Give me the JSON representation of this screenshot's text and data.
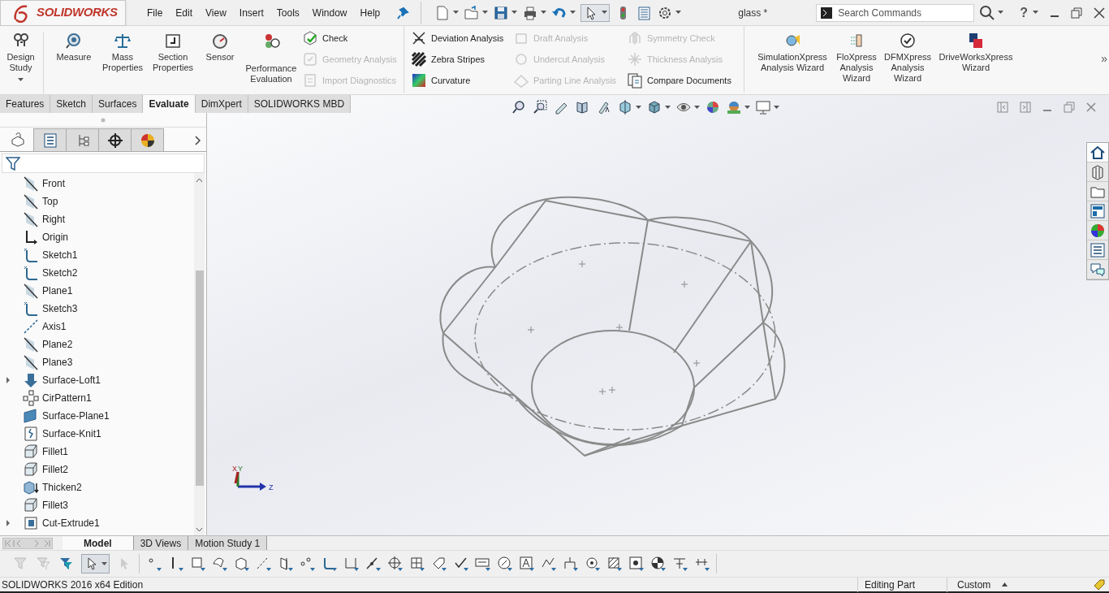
{
  "logo": "SOLIDWORKS",
  "menu": [
    "File",
    "Edit",
    "View",
    "Insert",
    "Tools",
    "Window",
    "Help"
  ],
  "document_title": "glass *",
  "search": {
    "placeholder": "Search Commands"
  },
  "help": "?",
  "ribbon": {
    "large_buttons": [
      {
        "label": "Design\nStudy",
        "dropdown": true
      },
      {
        "label": "Measure",
        "dropdown": false
      },
      {
        "label": "Mass\nProperties",
        "dropdown": false
      },
      {
        "label": "Section\nProperties",
        "dropdown": false
      },
      {
        "label": "Sensor",
        "dropdown": false
      },
      {
        "label": "Performance\nEvaluation",
        "dropdown": false
      }
    ],
    "small_groups": [
      [
        {
          "label": "Check",
          "disabled": false
        },
        {
          "label": "Geometry Analysis",
          "disabled": true
        },
        {
          "label": "Import Diagnostics",
          "disabled": true
        }
      ],
      [
        {
          "label": "Deviation Analysis",
          "disabled": false
        },
        {
          "label": "Zebra Stripes",
          "disabled": false
        },
        {
          "label": "Curvature",
          "disabled": false
        }
      ],
      [
        {
          "label": "Draft Analysis",
          "disabled": true
        },
        {
          "label": "Undercut Analysis",
          "disabled": true
        },
        {
          "label": "Parting Line Analysis",
          "disabled": true
        }
      ],
      [
        {
          "label": "Symmetry Check",
          "disabled": true
        },
        {
          "label": "Thickness Analysis",
          "disabled": true
        },
        {
          "label": "Compare Documents",
          "disabled": false
        }
      ]
    ],
    "wizards": [
      {
        "label": "SimulationXpress\nAnalysis Wizard"
      },
      {
        "label": "FloXpress\nAnalysis\nWizard"
      },
      {
        "label": "DFMXpress\nAnalysis\nWizard"
      },
      {
        "label": "DriveWorksXpress\nWizard"
      }
    ],
    "overflow": "»"
  },
  "command_tabs": [
    {
      "label": "Features",
      "selected": false
    },
    {
      "label": "Sketch",
      "selected": false
    },
    {
      "label": "Surfaces",
      "selected": false
    },
    {
      "label": "Evaluate",
      "selected": true
    },
    {
      "label": "DimXpert",
      "selected": false
    },
    {
      "label": "SOLIDWORKS MBD",
      "selected": false
    }
  ],
  "manager_tabs": [
    {
      "selected": true
    },
    {
      "selected": false
    },
    {
      "selected": false
    },
    {
      "selected": false
    },
    {
      "selected": false
    }
  ],
  "feature_tree": [
    {
      "label": "Front",
      "kind": "plane",
      "expandable": false
    },
    {
      "label": "Top",
      "kind": "plane",
      "expandable": false
    },
    {
      "label": "Right",
      "kind": "plane",
      "expandable": false
    },
    {
      "label": "Origin",
      "kind": "origin",
      "expandable": false
    },
    {
      "label": "Sketch1",
      "kind": "sketch",
      "expandable": false
    },
    {
      "label": "Sketch2",
      "kind": "sketch",
      "expandable": false
    },
    {
      "label": "Plane1",
      "kind": "plane",
      "expandable": false
    },
    {
      "label": "Sketch3",
      "kind": "sketch",
      "expandable": false
    },
    {
      "label": "Axis1",
      "kind": "axis",
      "expandable": false
    },
    {
      "label": "Plane2",
      "kind": "plane",
      "expandable": false
    },
    {
      "label": "Plane3",
      "kind": "plane",
      "expandable": false
    },
    {
      "label": "Surface-Loft1",
      "kind": "loft",
      "expandable": true
    },
    {
      "label": "CirPattern1",
      "kind": "pattern",
      "expandable": false
    },
    {
      "label": "Surface-Plane1",
      "kind": "surface",
      "expandable": false
    },
    {
      "label": "Surface-Knit1",
      "kind": "knit",
      "expandable": false
    },
    {
      "label": "Fillet1",
      "kind": "fillet",
      "expandable": false
    },
    {
      "label": "Fillet2",
      "kind": "fillet",
      "expandable": false
    },
    {
      "label": "Thicken2",
      "kind": "thicken",
      "expandable": false
    },
    {
      "label": "Fillet3",
      "kind": "fillet",
      "expandable": false
    },
    {
      "label": "Cut-Extrude1",
      "kind": "cut",
      "expandable": true
    }
  ],
  "triad": {
    "x": "X",
    "y": "Y",
    "z": "Z"
  },
  "bottom_tabs": [
    {
      "label": "Model",
      "selected": true
    },
    {
      "label": "3D Views",
      "selected": false
    },
    {
      "label": "Motion Study 1",
      "selected": false
    }
  ],
  "status_bar": {
    "edition": "SOLIDWORKS 2016 x64 Edition",
    "mode": "Editing Part",
    "units": "Custom"
  }
}
